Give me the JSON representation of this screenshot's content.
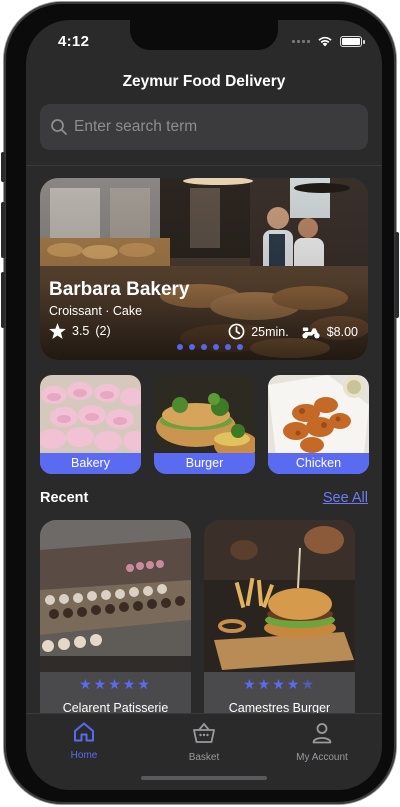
{
  "status": {
    "time": "4:12"
  },
  "app": {
    "title": "Zeymur Food Delivery"
  },
  "search": {
    "placeholder": "Enter search term",
    "value": ""
  },
  "featured": {
    "name": "Barbara Bakery",
    "tags": "Croissant · Cake",
    "rating": "3.5",
    "reviews": "(2)",
    "delivery_time": "25min.",
    "delivery_fee": "$8.00",
    "page_count": 6,
    "active_page": 1
  },
  "categories": [
    {
      "label": "Bakery"
    },
    {
      "label": "Burger"
    },
    {
      "label": "Chicken"
    }
  ],
  "recent": {
    "title": "Recent",
    "see_all": "See All",
    "items": [
      {
        "name": "Celarent Patisserie",
        "rating": 5
      },
      {
        "name": "Camestres Burger",
        "rating": 4.5
      }
    ]
  },
  "tabs": [
    {
      "label": "Home",
      "icon": "home-icon",
      "active": true
    },
    {
      "label": "Basket",
      "icon": "basket-icon",
      "active": false
    },
    {
      "label": "My Account",
      "icon": "account-icon",
      "active": false
    }
  ],
  "colors": {
    "accent": "#5a6bf2",
    "background": "#2a2a2b",
    "field": "#3b3b3d",
    "link": "#6b7cf6"
  }
}
